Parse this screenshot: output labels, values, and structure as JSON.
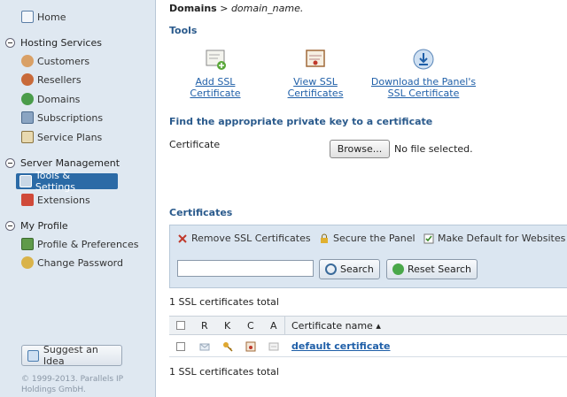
{
  "sidebar": {
    "home": "Home",
    "groups": [
      {
        "label": "Hosting Services",
        "items": [
          "Customers",
          "Resellers",
          "Domains",
          "Subscriptions",
          "Service Plans"
        ]
      },
      {
        "label": "Server Management",
        "items": [
          "Tools & Settings",
          "Extensions"
        ]
      },
      {
        "label": "My Profile",
        "items": [
          "Profile & Preferences",
          "Change Password"
        ]
      }
    ],
    "suggest_label": "Suggest an Idea",
    "copyright": "© 1999-2013. Parallels IP Holdings GmbH."
  },
  "breadcrumb": {
    "root": "Domains",
    "sep": " > ",
    "current": "domain_name."
  },
  "tools": {
    "title": "Tools",
    "items": [
      {
        "line1": "Add SSL Certificate",
        "line2": ""
      },
      {
        "line1": "View SSL Certificates",
        "line2": ""
      },
      {
        "line1": "Download the Panel's",
        "line2": "SSL Certificate"
      }
    ]
  },
  "key_finder": {
    "title": "Find the appropriate private key to a certificate",
    "label": "Certificate",
    "browse": "Browse...",
    "no_file": "No file selected."
  },
  "certificates": {
    "title": "Certificates",
    "toolbar": {
      "remove": "Remove SSL Certificates",
      "secure": "Secure the Panel",
      "make_default": "Make Default for Websites"
    },
    "search_placeholder": "",
    "search_btn": "Search",
    "reset_btn": "Reset Search",
    "total_top": "1 SSL certificates total",
    "total_bottom": "1 SSL certificates total",
    "columns": {
      "r": "R",
      "k": "K",
      "c": "C",
      "a": "A",
      "name": "Certificate name ▴"
    },
    "rows": [
      {
        "name": "default certificate"
      }
    ]
  }
}
